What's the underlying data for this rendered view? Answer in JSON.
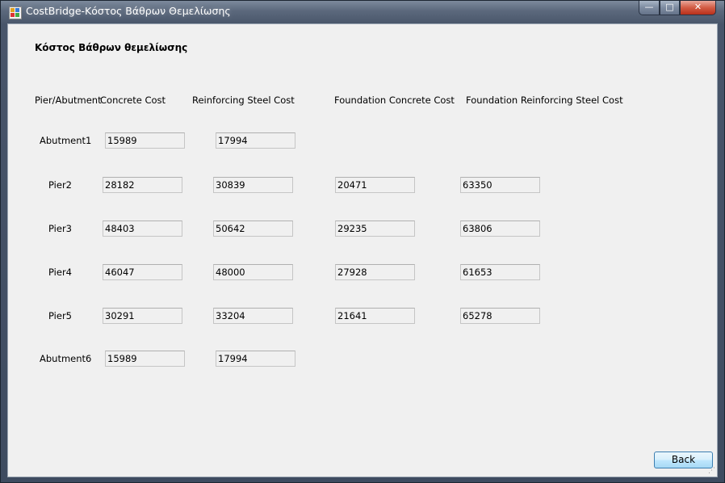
{
  "window": {
    "title": "CostBridge-Κόστος Βάθρων Θεμελίωσης",
    "minimize_glyph": "—",
    "maximize_glyph": "□",
    "close_glyph": "✕"
  },
  "form": {
    "heading": "Κόστος Βάθρων θεμελίωσης",
    "columns": {
      "element": "Pier/Abutment",
      "concrete": "Concrete Cost",
      "steel": "Reinforcing Steel Cost",
      "foundation_concrete": "Foundation Concrete Cost",
      "foundation_steel": "Foundation Reinforcing Steel Cost"
    },
    "rows": [
      {
        "label": "Abutment1",
        "concrete": "15989",
        "steel": "17994"
      },
      {
        "label": "Pier2",
        "concrete": "28182",
        "steel": "30839",
        "foundation_concrete": "20471",
        "foundation_steel": "63350"
      },
      {
        "label": "Pier3",
        "concrete": "48403",
        "steel": "50642",
        "foundation_concrete": "29235",
        "foundation_steel": "63806"
      },
      {
        "label": "Pier4",
        "concrete": "46047",
        "steel": "48000",
        "foundation_concrete": "27928",
        "foundation_steel": "61653"
      },
      {
        "label": "Pier5",
        "concrete": "30291",
        "steel": "33204",
        "foundation_concrete": "21641",
        "foundation_steel": "65278"
      },
      {
        "label": "Abutment6",
        "concrete": "15989",
        "steel": "17994"
      }
    ],
    "back_label": "Back"
  }
}
